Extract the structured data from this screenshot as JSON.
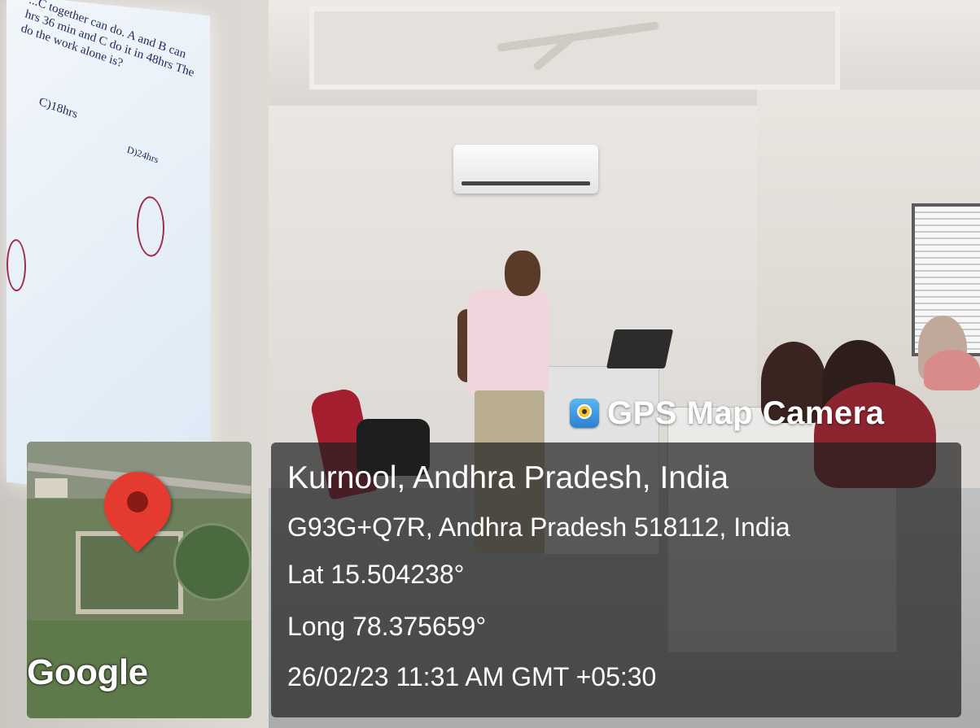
{
  "overlay": {
    "brand": "GPS Map Camera",
    "brand_icon": "gps-map-camera-icon",
    "city": "Kurnool, Andhra Pradesh, India",
    "address": "G93G+Q7R, Andhra Pradesh 518112, India",
    "latitude": "Lat 15.504238°",
    "longitude": "Long 78.375659°",
    "datetime": "26/02/23 11:31 AM GMT +05:30"
  },
  "map": {
    "provider_logo": "Google",
    "pin_icon": "map-pin-icon",
    "pin_color": "#e53a2f"
  },
  "projection": {
    "line1": "...C together can do. A and B can",
    "line2": "hrs 36 min and C do it in 48hrs The",
    "line3": "do the work alone is?",
    "option_c": "C)18hrs",
    "option_d": "D)24hrs"
  }
}
